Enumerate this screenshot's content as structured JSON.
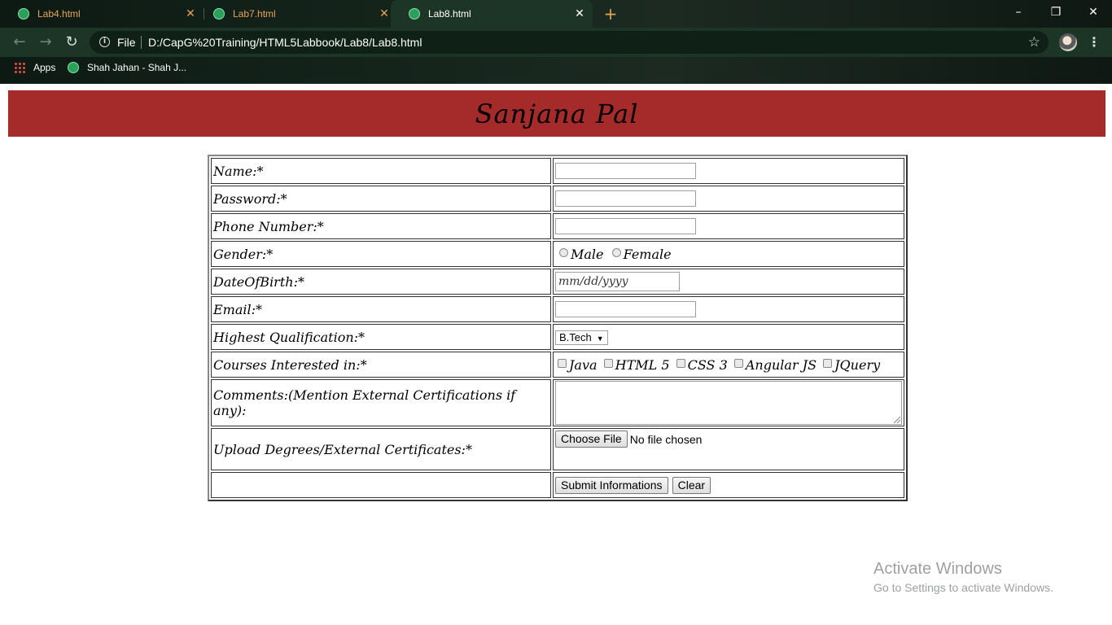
{
  "browser": {
    "tabs": [
      {
        "title": "Lab4.html",
        "active": false
      },
      {
        "title": "Lab7.html",
        "active": false
      },
      {
        "title": "Lab8.html",
        "active": true
      }
    ],
    "omnibox": {
      "scheme_label": "File",
      "url": "D:/CapG%20Training/HTML5Labbook/Lab8/Lab8.html"
    },
    "bookmarks": [
      {
        "label": "Apps",
        "icon": "apps-grid-icon"
      },
      {
        "label": "Shah Jahan - Shah J...",
        "icon": "globe-icon"
      }
    ],
    "colors": {
      "tab_inactive_text": "#e8a35a",
      "toolbar": "#1d3526"
    }
  },
  "page": {
    "banner_title": "Sanjana Pal",
    "banner_color": "#a52a2a",
    "form": {
      "name_label": "Name:*",
      "password_label": "Password:*",
      "phone_label": "Phone Number:*",
      "gender_label": "Gender:*",
      "gender_options": [
        "Male",
        "Female"
      ],
      "dob_label": "DateOfBirth:*",
      "dob_placeholder": "mm/dd/yyyy",
      "email_label": "Email:*",
      "qualification_label": "Highest Qualification:*",
      "qualification_selected": "B.Tech",
      "courses_label": "Courses Interested in:*",
      "courses": [
        "Java",
        "HTML 5",
        "CSS 3",
        "Angular JS",
        "JQuery"
      ],
      "comments_label": "Comments:(Mention External Certifications if any):",
      "upload_label": "Upload Degrees/External Certificates:*",
      "choose_file_label": "Choose File",
      "no_file_text": "No file chosen",
      "submit_label": "Submit Informations",
      "clear_label": "Clear"
    }
  },
  "watermark": {
    "line1": "Activate Windows",
    "line2": "Go to Settings to activate Windows."
  }
}
